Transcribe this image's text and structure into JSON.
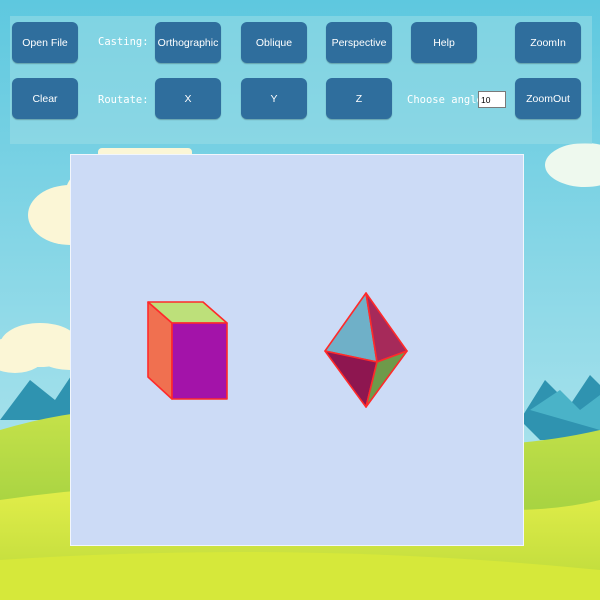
{
  "toolbar": {
    "open_file": "Open File",
    "clear": "Clear",
    "casting_label": "Casting:",
    "rotate_label": "Routate:",
    "orthographic": "Orthographic",
    "oblique": "Oblique",
    "perspective": "Perspective",
    "help": "Help",
    "zoom_in": "ZoomIn",
    "zoom_out": "ZoomOut",
    "rotate_x": "X",
    "rotate_y": "Y",
    "rotate_z": "Z",
    "angle_label": "Choose angle:",
    "angle_value": "10"
  },
  "colors": {
    "button": "#2f6e9d",
    "canvas_bg": "#ccdbf6",
    "edge": "#ff2a2a",
    "cube_front": "#a313a9",
    "cube_side": "#f07050",
    "cube_top": "#bde07a",
    "oct_top_left": "#6fb0c8",
    "oct_top_right": "#a62a5a",
    "oct_bottom_left": "#8e1650",
    "oct_bottom_right": "#6e9a4a"
  },
  "scene": {
    "shapes": [
      "cube",
      "octahedron"
    ]
  }
}
